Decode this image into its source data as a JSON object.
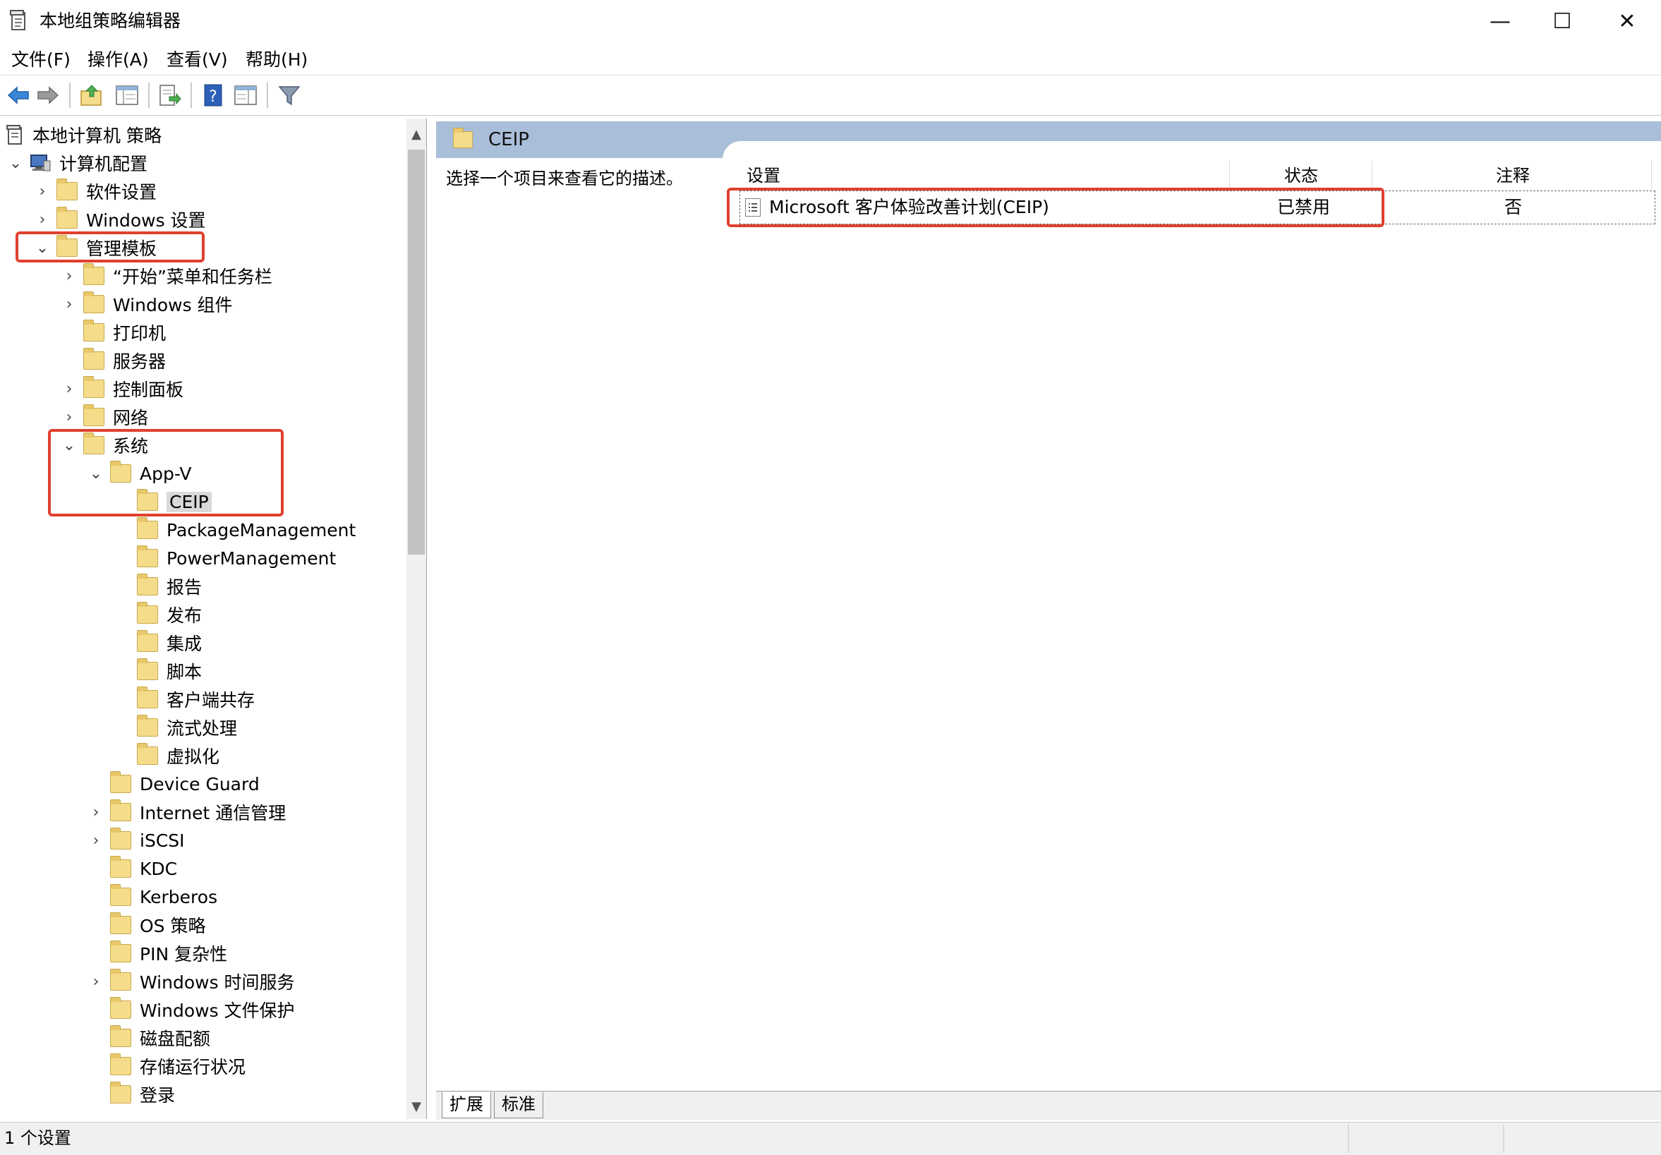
{
  "window": {
    "title": "本地组策略编辑器",
    "minimize": "—",
    "maximize": "☐",
    "close": "✕"
  },
  "menu": [
    "文件(F)",
    "操作(A)",
    "查看(V)",
    "帮助(H)"
  ],
  "toolbar": {
    "icons": [
      "back-arrow-icon",
      "forward-arrow-icon",
      "up-folder-icon",
      "show-hide-tree-icon",
      "export-list-icon",
      "help-icon",
      "properties-icon",
      "filter-icon"
    ]
  },
  "tree": {
    "root": "本地计算机 策略",
    "computer_config": "计算机配置",
    "software_settings": "软件设置",
    "windows_settings": "Windows 设置",
    "admin_templates": "管理模板",
    "start_menu": "“开始”菜单和任务栏",
    "windows_components": "Windows 组件",
    "printers": "打印机",
    "server": "服务器",
    "control_panel": "控制面板",
    "network": "网络",
    "system": "系统",
    "appv": "App-V",
    "ceip": "CEIP",
    "package_mgmt": "PackageManagement",
    "power_mgmt": "PowerManagement",
    "reporting": "报告",
    "publishing": "发布",
    "integration": "集成",
    "scripts": "脚本",
    "client_coexistence": "客户端共存",
    "streaming": "流式处理",
    "virtualization": "虚拟化",
    "device_guard": "Device Guard",
    "internet_comm": "Internet 通信管理",
    "iscsi": "iSCSI",
    "kdc": "KDC",
    "kerberos": "Kerberos",
    "os_policy": "OS 策略",
    "pin_complexity": "PIN 复杂性",
    "windows_time": "Windows 时间服务",
    "windows_file_protection": "Windows 文件保护",
    "disk_quota": "磁盘配额",
    "storage_health": "存储运行状况",
    "logon": "登录"
  },
  "right": {
    "header_title": "CEIP",
    "description_prompt": "选择一个项目来查看它的描述。",
    "columns": [
      "设置",
      "状态",
      "注释"
    ],
    "rows": [
      {
        "setting": "Microsoft 客户体验改善计划(CEIP)",
        "state": "已禁用",
        "comment": "否"
      }
    ]
  },
  "tabs": [
    "扩展",
    "标准"
  ],
  "status": {
    "text": "1 个设置"
  },
  "colors": {
    "header_band": "#a9bed8",
    "annotation": "#e0402e",
    "folder": "#f4dc8b"
  }
}
